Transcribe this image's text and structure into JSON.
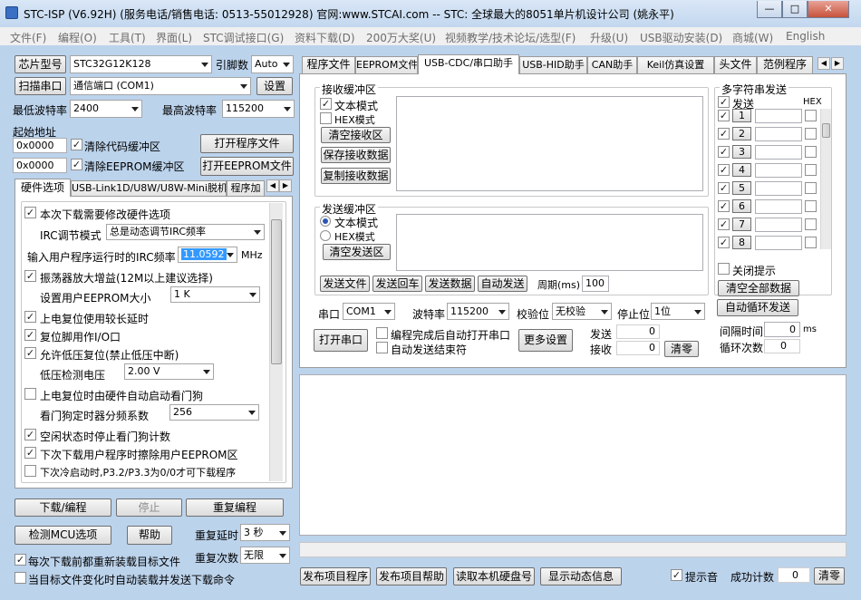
{
  "window": {
    "title": "STC-ISP (V6.92H) (服务电话/销售电话: 0513-55012928) 官网:www.STCAI.com  -- STC: 全球最大的8051单片机设计公司 (姚永平)",
    "controls": [
      "—",
      "□",
      "✕"
    ]
  },
  "menu": [
    "文件(F)",
    "编程(O)",
    "工具(T)",
    "界面(L)",
    "STC调试接口(G)",
    "资料下载(D)",
    "200万大奖(U)",
    "视频教学/技术论坛/选型(F)",
    "升级(U)",
    "USB驱动安装(D)",
    "商城(W)",
    "English"
  ],
  "left": {
    "chip_model_btn": "芯片型号",
    "chip_model": "STC32G12K128",
    "pin_count_label": "引脚数",
    "pin_count": "Auto",
    "scan_port_btn": "扫描串口",
    "port": "通信端口 (COM1)",
    "settings_btn": "设置",
    "min_baud_label": "最低波特率",
    "min_baud": "2400",
    "max_baud_label": "最高波特率",
    "max_baud": "115200",
    "start_addr_label": "起始地址",
    "code_addr": "0x0000",
    "clear_code_label": "清除代码缓冲区",
    "open_program_btn": "打开程序文件",
    "eeprom_addr": "0x0000",
    "clear_eeprom_label": "清除EEPROM缓冲区",
    "open_eeprom_btn": "打开EEPROM文件",
    "tabs": [
      "硬件选项",
      "USB-Link1D/U8W/U8W-Mini脱机",
      "程序加"
    ],
    "hw": {
      "modify_hw": "本次下载需要修改硬件选项",
      "irc_mode_label": "IRC调节模式",
      "irc_mode": "总是动态调节IRC频率",
      "irc_freq_label": "输入用户程序运行时的IRC频率",
      "irc_freq": "11.0592",
      "irc_unit": "MHz",
      "osc_gain": "振荡器放大增益(12M以上建议选择)",
      "eeprom_size_label": "设置用户EEPROM大小",
      "eeprom_size": "1    K",
      "long_delay": "上电复位使用较长延时",
      "reset_pin": "复位脚用作I/O口",
      "lvr": "允许低压复位(禁止低压中断)",
      "lvd_label": "低压检测电压",
      "lvd": "2.00 V",
      "wdt_auto": "上电复位时由硬件自动启动看门狗",
      "wdt_div_label": "看门狗定时器分频系数",
      "wdt_div": "256",
      "idle_wdt": "空闲状态时停止看门狗计数",
      "erase_eeprom": "下次下载用户程序时擦除用户EEPROM区",
      "p32p33": "下次冷启动时,P3.2/P3.3为0/0才可下载程序"
    },
    "download_btn": "下载/编程",
    "stop_btn": "停止",
    "reprogram_btn": "重复编程",
    "check_mcu_btn": "检测MCU选项",
    "help_btn": "帮助",
    "repeat_delay_label": "重复延时",
    "repeat_delay": "3 秒",
    "repeat_count_label": "重复次数",
    "repeat_count": "无限",
    "reload_each": "每次下载前都重新装载目标文件",
    "auto_reload": "当目标文件变化时自动装载并发送下载命令"
  },
  "right": {
    "tabs": [
      "程序文件",
      "EEPROM文件",
      "USB-CDC/串口助手",
      "USB-HID助手",
      "CAN助手",
      "Keil仿真设置",
      "头文件",
      "范例程序"
    ],
    "recv": {
      "title": "接收缓冲区",
      "text_mode": "文本模式",
      "hex_mode": "HEX模式",
      "clear_btn": "清空接收区",
      "save_btn": "保存接收数据",
      "copy_btn": "复制接收数据"
    },
    "send": {
      "title": "发送缓冲区",
      "text_mode": "文本模式",
      "hex_mode": "HEX模式",
      "clear_btn": "清空发送区",
      "send_file_btn": "发送文件",
      "send_enter_btn": "发送回车",
      "send_data_btn": "发送数据",
      "auto_send_btn": "自动发送",
      "period_label": "周期(ms)",
      "period": "100"
    },
    "multi": {
      "title": "多字符串发送",
      "send_label": "发送",
      "hex_label": "HEX",
      "rows": [
        "1",
        "2",
        "3",
        "4",
        "5",
        "6",
        "7",
        "8"
      ],
      "close_tips": "关闭提示",
      "clear_all_btn": "清空全部数据",
      "auto_loop_btn": "自动循环发送",
      "interval_label": "间隔时间",
      "interval": "0",
      "interval_unit": "ms",
      "loop_count_label": "循环次数",
      "loop_count": "0"
    },
    "port": {
      "port_label": "串口",
      "port": "COM1",
      "baud_label": "波特率",
      "baud": "115200",
      "parity_label": "校验位",
      "parity": "无校验",
      "stop_label": "停止位",
      "stop": "1位",
      "open_btn": "打开串口",
      "auto_open": "编程完成后自动打开串口",
      "auto_end": "自动发送结束符",
      "more_btn": "更多设置",
      "sent_label": "发送",
      "sent": "0",
      "recv_label": "接收",
      "recv": "0",
      "clear_btn": "清零"
    },
    "bottom": {
      "publish_prog_btn": "发布项目程序",
      "publish_help_btn": "发布项目帮助",
      "read_disk_btn": "读取本机硬盘号",
      "show_dynamic_btn": "显示动态信息",
      "beep_label": "提示音",
      "success_label": "成功计数",
      "success": "0",
      "clear_btn": "清零"
    }
  }
}
